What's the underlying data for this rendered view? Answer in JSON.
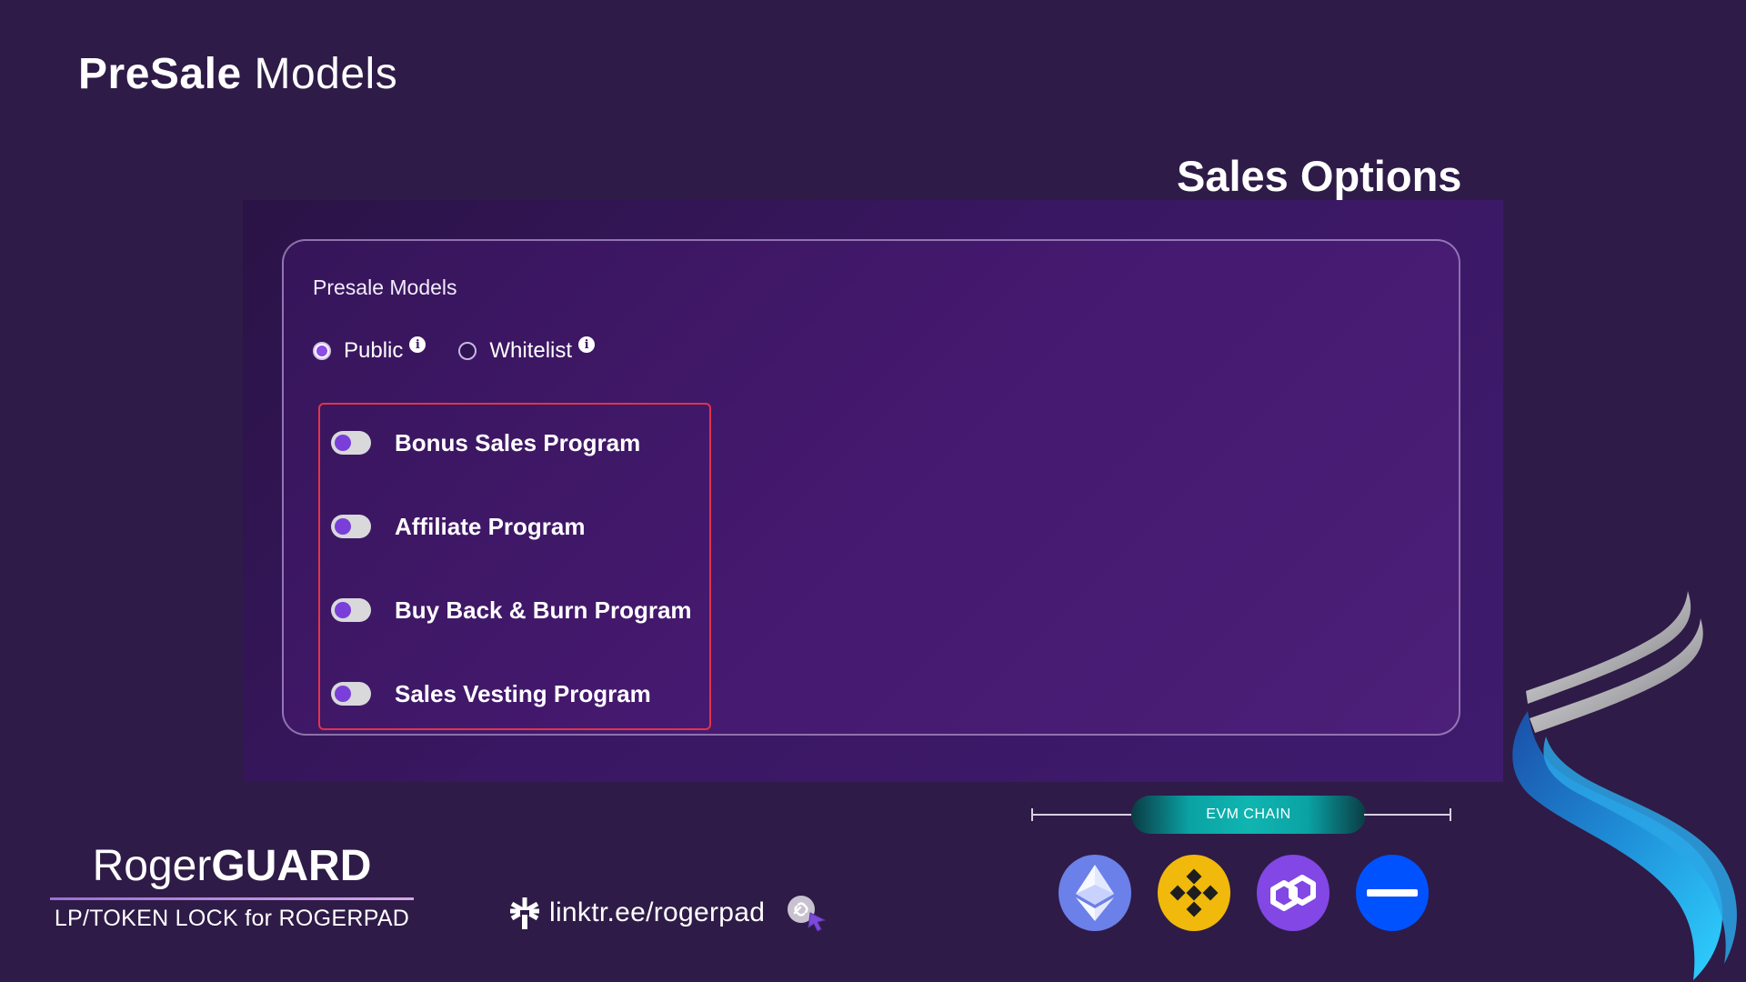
{
  "header": {
    "title_bold": "PreSale",
    "title_light": "Models",
    "section_heading": "Sales Options"
  },
  "card": {
    "title": "Presale Models",
    "radios": [
      {
        "label": "Public",
        "checked": true
      },
      {
        "label": "Whitelist",
        "checked": false
      }
    ],
    "programs": [
      {
        "label": "Bonus Sales Program",
        "enabled": false
      },
      {
        "label": "Affiliate Program",
        "enabled": false
      },
      {
        "label": "Buy Back & Burn Program",
        "enabled": false
      },
      {
        "label": "Sales Vesting Program",
        "enabled": false
      }
    ]
  },
  "chains": {
    "label": "EVM CHAIN",
    "icons": [
      {
        "name": "ethereum-icon",
        "color": "#6b80e8"
      },
      {
        "name": "binance-icon",
        "color": "#f0b90b"
      },
      {
        "name": "polygon-icon",
        "color": "#8247e5"
      },
      {
        "name": "chain-minus-icon",
        "color": "#0052ff"
      }
    ]
  },
  "footer": {
    "brand_light": "Roger",
    "brand_bold": "GUARD",
    "tagline": "LP/TOKEN LOCK for ROGERPAD",
    "link": "linktr.ee/rogerpad"
  },
  "colors": {
    "background": "#2e1b47",
    "accent_purple": "#8e4be6",
    "highlight_border": "#e0344a",
    "evm_teal": "#10b5b0"
  }
}
